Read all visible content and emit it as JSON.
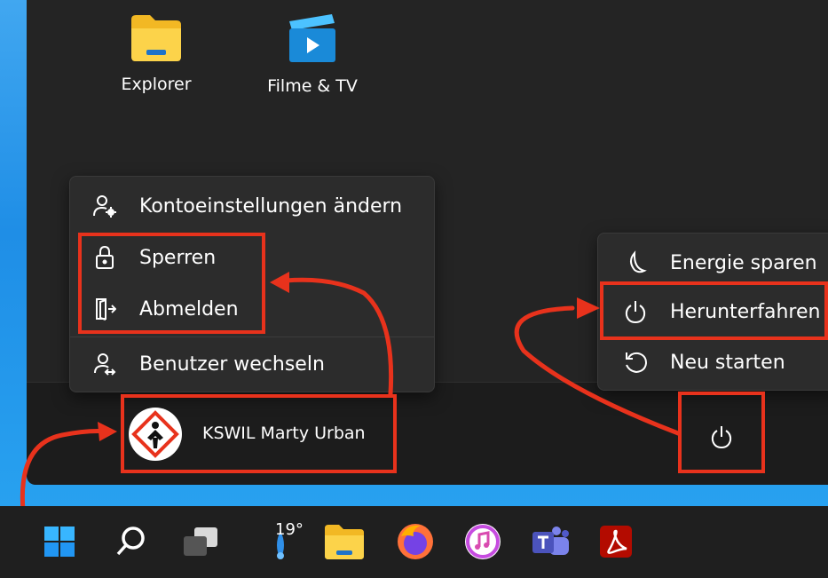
{
  "pinned": {
    "explorer_label": "Explorer",
    "films_label": "Filme & TV"
  },
  "account_menu": {
    "items": [
      {
        "label": "Kontoeinstellungen ändern",
        "icon": "account-settings-icon"
      },
      {
        "label": "Sperren",
        "icon": "lock-icon"
      },
      {
        "label": "Abmelden",
        "icon": "sign-out-icon"
      },
      {
        "label": "Benutzer wechseln",
        "icon": "switch-user-icon"
      }
    ]
  },
  "power_menu": {
    "items": [
      {
        "label": "Energie sparen",
        "icon": "moon-icon"
      },
      {
        "label": "Herunterfahren",
        "icon": "power-icon"
      },
      {
        "label": "Neu starten",
        "icon": "restart-icon"
      }
    ]
  },
  "user": {
    "name": "KSWIL Marty Urban"
  },
  "taskbar": {
    "weather_temp": "19°",
    "icons": [
      "windows-start-icon",
      "search-icon",
      "task-view-icon",
      "weather-icon",
      "file-explorer-icon",
      "firefox-icon",
      "itunes-icon",
      "teams-icon",
      "acrobat-icon"
    ]
  },
  "colors": {
    "annotation_red": "#e8321c",
    "panel_bg": "#242424",
    "menu_bg": "#2c2c2c"
  }
}
